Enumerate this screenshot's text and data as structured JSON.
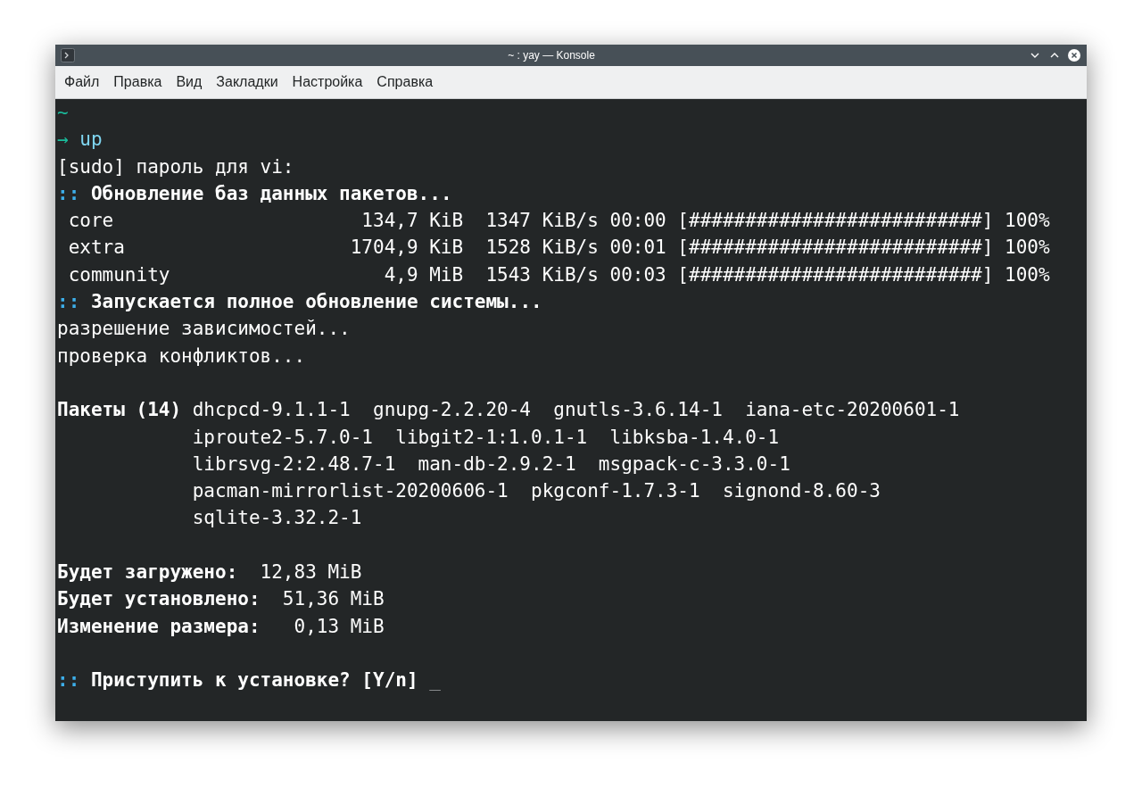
{
  "window": {
    "title": "~ : yay — Konsole"
  },
  "menu": [
    "Файл",
    "Правка",
    "Вид",
    "Закладки",
    "Настройка",
    "Справка"
  ],
  "terminal": {
    "lines": [
      {
        "segments": [
          {
            "kind": "cwd",
            "text": "~"
          }
        ]
      },
      {
        "segments": [
          {
            "kind": "arrow",
            "text": "→"
          },
          {
            "kind": "command",
            "text": " up"
          }
        ]
      },
      {
        "segments": [
          {
            "kind": "plain",
            "text": "[sudo] пароль для vi:"
          }
        ]
      },
      {
        "segments": [
          {
            "kind": "marker",
            "text": "::"
          },
          {
            "kind": "bold",
            "text": " Обновление баз данных пакетов..."
          }
        ]
      },
      {
        "segments": [
          {
            "kind": "plain",
            "text": " core                      134,7 KiB  1347 KiB/s 00:00 [##########################] 100%"
          }
        ]
      },
      {
        "segments": [
          {
            "kind": "plain",
            "text": " extra                    1704,9 KiB  1528 KiB/s 00:01 [##########################] 100%"
          }
        ]
      },
      {
        "segments": [
          {
            "kind": "plain",
            "text": " community                   4,9 MiB  1543 KiB/s 00:03 [##########################] 100%"
          }
        ]
      },
      {
        "segments": [
          {
            "kind": "marker",
            "text": "::"
          },
          {
            "kind": "bold",
            "text": " Запускается полное обновление системы..."
          }
        ]
      },
      {
        "segments": [
          {
            "kind": "plain",
            "text": "разрешение зависимостей..."
          }
        ]
      },
      {
        "segments": [
          {
            "kind": "plain",
            "text": "проверка конфликтов..."
          }
        ]
      },
      {
        "blank_before": true,
        "segments": [
          {
            "kind": "bold",
            "text": "Пакеты (14)"
          },
          {
            "kind": "plain",
            "text": " dhcpcd-9.1.1-1  gnupg-2.2.20-4  gnutls-3.6.14-1  iana-etc-20200601-1"
          }
        ]
      },
      {
        "segments": [
          {
            "kind": "plain",
            "text": "            iproute2-5.7.0-1  libgit2-1:1.0.1-1  libksba-1.4.0-1"
          }
        ]
      },
      {
        "segments": [
          {
            "kind": "plain",
            "text": "            librsvg-2:2.48.7-1  man-db-2.9.2-1  msgpack-c-3.3.0-1"
          }
        ]
      },
      {
        "segments": [
          {
            "kind": "plain",
            "text": "            pacman-mirrorlist-20200606-1  pkgconf-1.7.3-1  signond-8.60-3"
          }
        ]
      },
      {
        "segments": [
          {
            "kind": "plain",
            "text": "            sqlite-3.32.2-1"
          }
        ]
      },
      {
        "blank_before": true,
        "segments": [
          {
            "kind": "bold",
            "text": "Будет загружено:"
          },
          {
            "kind": "plain",
            "text": "  12,83 MiB"
          }
        ]
      },
      {
        "segments": [
          {
            "kind": "bold",
            "text": "Будет установлено:"
          },
          {
            "kind": "plain",
            "text": "  51,36 MiB"
          }
        ]
      },
      {
        "segments": [
          {
            "kind": "bold",
            "text": "Изменение размера:"
          },
          {
            "kind": "plain",
            "text": "   0,13 MiB"
          }
        ]
      },
      {
        "blank_before": true,
        "segments": [
          {
            "kind": "marker",
            "text": "::"
          },
          {
            "kind": "bold",
            "text": " Приступить к установке? [Y/n] "
          },
          {
            "kind": "cursor",
            "text": "_"
          }
        ]
      }
    ]
  }
}
